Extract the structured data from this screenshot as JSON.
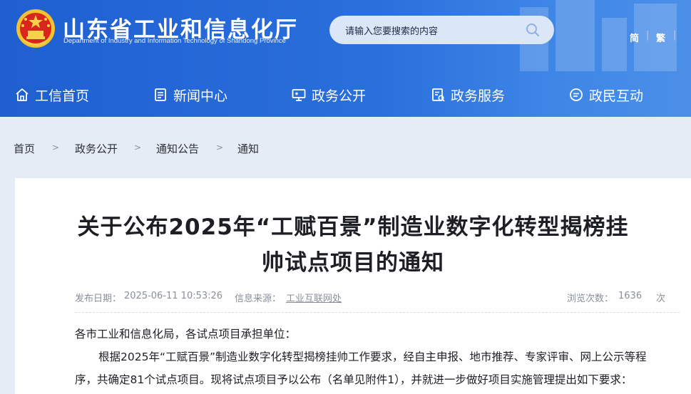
{
  "header": {
    "site_title": "山东省工业和信息化厅",
    "site_subtitle": "Department of Industry and Information Technology of Shandong Province",
    "search_placeholder": "请输入您要搜索的内容",
    "lang_simplified": "简",
    "lang_traditional": "繁",
    "lang_sep": "|"
  },
  "nav": {
    "items": [
      {
        "label": "工信首页",
        "icon": "home-icon"
      },
      {
        "label": "新闻中心",
        "icon": "news-icon"
      },
      {
        "label": "政务公开",
        "icon": "monitor-icon"
      },
      {
        "label": "政务服务",
        "icon": "service-icon"
      },
      {
        "label": "政民互动",
        "icon": "chat-icon"
      }
    ]
  },
  "breadcrumb": {
    "items": [
      "首页",
      "政务公开",
      "通知公告",
      "通知"
    ],
    "separator": ">"
  },
  "article": {
    "title_line1": "关于公布2025年“工赋百景”制造业数字化转型揭榜挂",
    "title_line2": "帅试点项目的通知",
    "publish_label": "发布日期：",
    "publish_date": "2025-06-11 10:53:26",
    "source_label": "信息来源：",
    "source": "工业互联网处",
    "views_label": "浏览次数：",
    "views": "1636",
    "views_unit": "次",
    "salutation": "各市工业和信息化局，各试点项目承担单位：",
    "para1_line1": "根据2025年“工赋百景”制造业数字化转型揭榜挂帅工作要求，经自主申报、地市推荐、专家评审、网上公示等程",
    "para1_line2": "序，共确定81个试点项目。现将试点项目予以公布（名单见附件1），并就进一步做好项目实施管理提出如下要求："
  },
  "colors": {
    "header_blue": "#2a6fdc",
    "page_bg": "#e6ecf6"
  }
}
